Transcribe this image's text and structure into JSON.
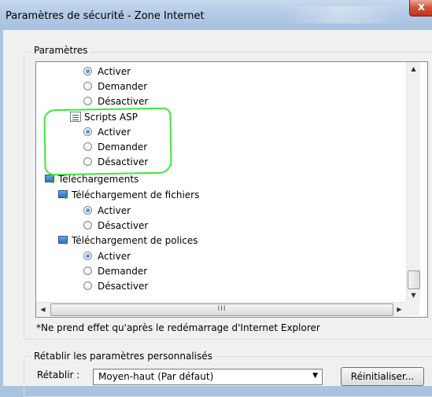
{
  "window": {
    "title": "Paramètres de sécurité - Zone Internet",
    "close_label": "x"
  },
  "settings_group": {
    "label": "Paramètres",
    "tree": [
      {
        "type": "radio",
        "label": "Activer",
        "checked": true
      },
      {
        "type": "radio",
        "label": "Demander",
        "checked": false
      },
      {
        "type": "radio",
        "label": "Désactiver",
        "checked": false
      },
      {
        "type": "category",
        "icon": "script-icon",
        "label": "Scripts ASP"
      },
      {
        "type": "radio",
        "label": "Activer",
        "checked": true
      },
      {
        "type": "radio",
        "label": "Demander",
        "checked": false
      },
      {
        "type": "radio",
        "label": "Désactiver",
        "checked": false
      },
      {
        "type": "category",
        "icon": "download-icon",
        "label": "Téléchargements"
      },
      {
        "type": "category",
        "icon": "download-icon",
        "label": "Téléchargement de fichiers"
      },
      {
        "type": "radio",
        "label": "Activer",
        "checked": true
      },
      {
        "type": "radio",
        "label": "Désactiver",
        "checked": false
      },
      {
        "type": "category",
        "icon": "download-icon",
        "label": "Téléchargement de polices"
      },
      {
        "type": "radio",
        "label": "Activer",
        "checked": true
      },
      {
        "type": "radio",
        "label": "Demander",
        "checked": false
      },
      {
        "type": "radio",
        "label": "Désactiver",
        "checked": false
      }
    ],
    "note": "*Ne prend effet qu'après le redémarrage d'Internet Explorer"
  },
  "reset_group": {
    "label": "Rétablir les paramètres personnalisés",
    "reset_label": "Rétablir :",
    "selected_level": "Moyen-haut (Par défaut)",
    "reset_button": "Réinitialiser..."
  },
  "hscroll_grip": "III",
  "colors": {
    "annotation": "#3ee63e",
    "radio_checked": "#1f5fb5"
  }
}
